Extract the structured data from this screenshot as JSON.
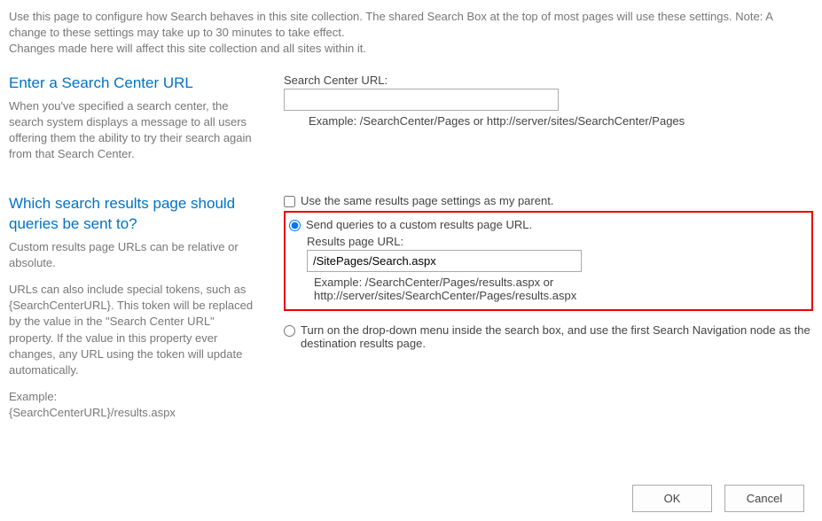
{
  "intro": {
    "line1": "Use this page to configure how Search behaves in this site collection. The shared Search Box at the top of most pages will use these settings. Note: A change to these settings may take up to 30 minutes to take effect.",
    "line2": "Changes made here will affect this site collection and all sites within it."
  },
  "section1": {
    "heading": "Enter a Search Center URL",
    "desc": "When you've specified a search center, the search system displays a message to all users offering them the ability to try their search again from that Search Center.",
    "field_label": "Search Center URL:",
    "field_value": "",
    "example": "Example: /SearchCenter/Pages or http://server/sites/SearchCenter/Pages"
  },
  "section2": {
    "heading": "Which search results page should queries be sent to?",
    "desc1": "Custom results page URLs can be relative or absolute.",
    "desc2": "URLs can also include special tokens, such as {SearchCenterURL}. This token will be replaced by the value in the \"Search Center URL\" property. If the value in this property ever changes, any URL using the token will update automatically.",
    "desc3a": "Example:",
    "desc3b": "{SearchCenterURL}/results.aspx",
    "checkbox_label": "Use the same results page settings as my parent.",
    "radio1_label": "Send queries to a custom results page URL.",
    "results_label": "Results page URL:",
    "results_value": "/SitePages/Search.aspx",
    "results_example": "Example: /SearchCenter/Pages/results.aspx or http://server/sites/SearchCenter/Pages/results.aspx",
    "radio2_label": "Turn on the drop-down menu inside the search box, and use the first Search Navigation node as the destination results page."
  },
  "buttons": {
    "ok": "OK",
    "cancel": "Cancel"
  }
}
